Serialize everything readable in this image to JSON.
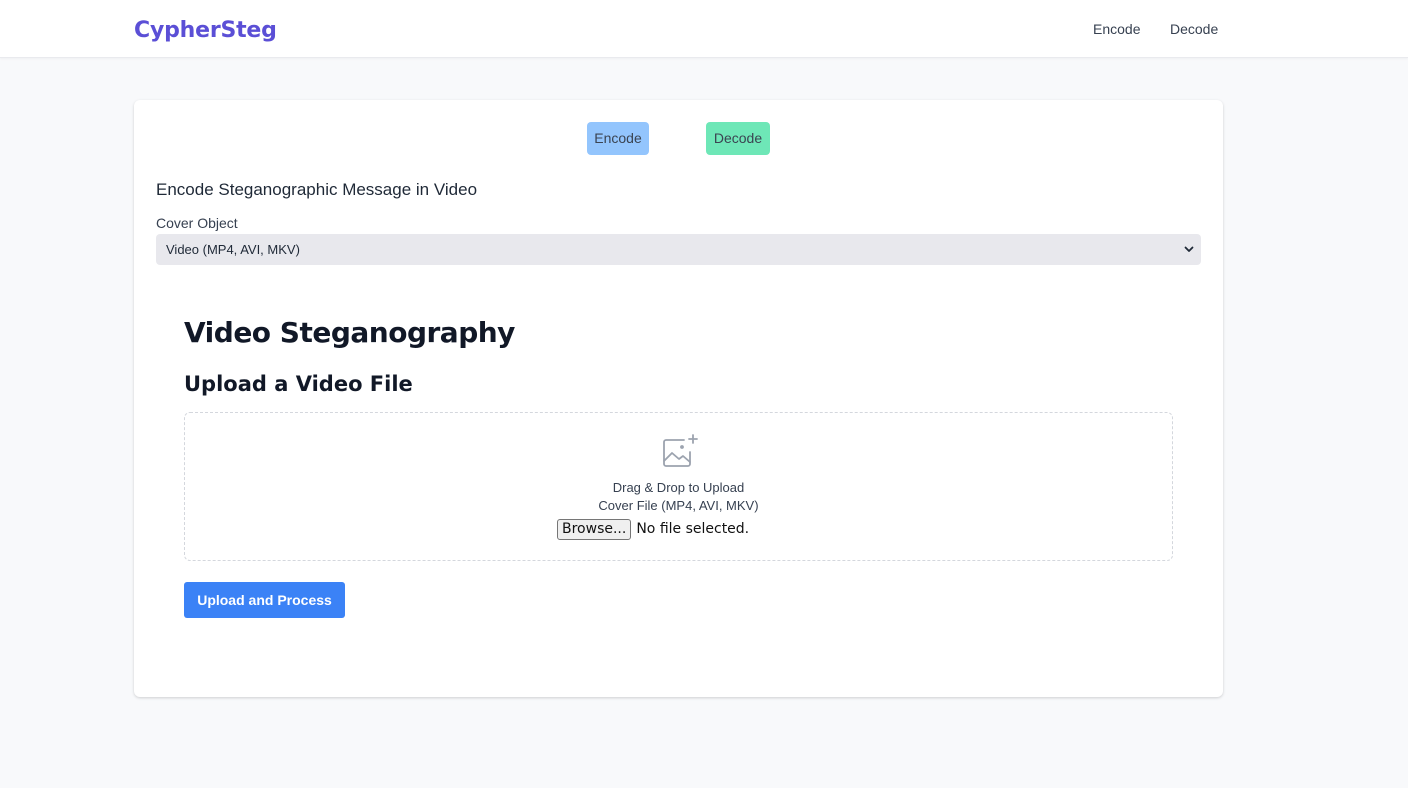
{
  "brand": {
    "name": "CypherSteg",
    "color": "#5b4fd6"
  },
  "nav": {
    "items": [
      {
        "label": "Encode"
      },
      {
        "label": "Decode"
      }
    ]
  },
  "mode_buttons": {
    "encode": {
      "label": "Encode",
      "color": "#93c5fd"
    },
    "decode": {
      "label": "Decode",
      "color": "#6ee7b7"
    }
  },
  "form": {
    "title": "Encode Steganographic Message in Video",
    "cover_label": "Cover Object",
    "cover_selected": "Video (MP4, AVI, MKV)"
  },
  "content": {
    "heading": "Video Steganography",
    "subheading": "Upload a Video File",
    "dropzone": {
      "icon": "image-plus-icon",
      "line1": "Drag & Drop to Upload",
      "line2": "Cover File (MP4, AVI, MKV)",
      "browse_label": "Browse...",
      "file_status": "No file selected."
    },
    "submit_label": "Upload and Process",
    "submit_color": "#3b82f6"
  }
}
